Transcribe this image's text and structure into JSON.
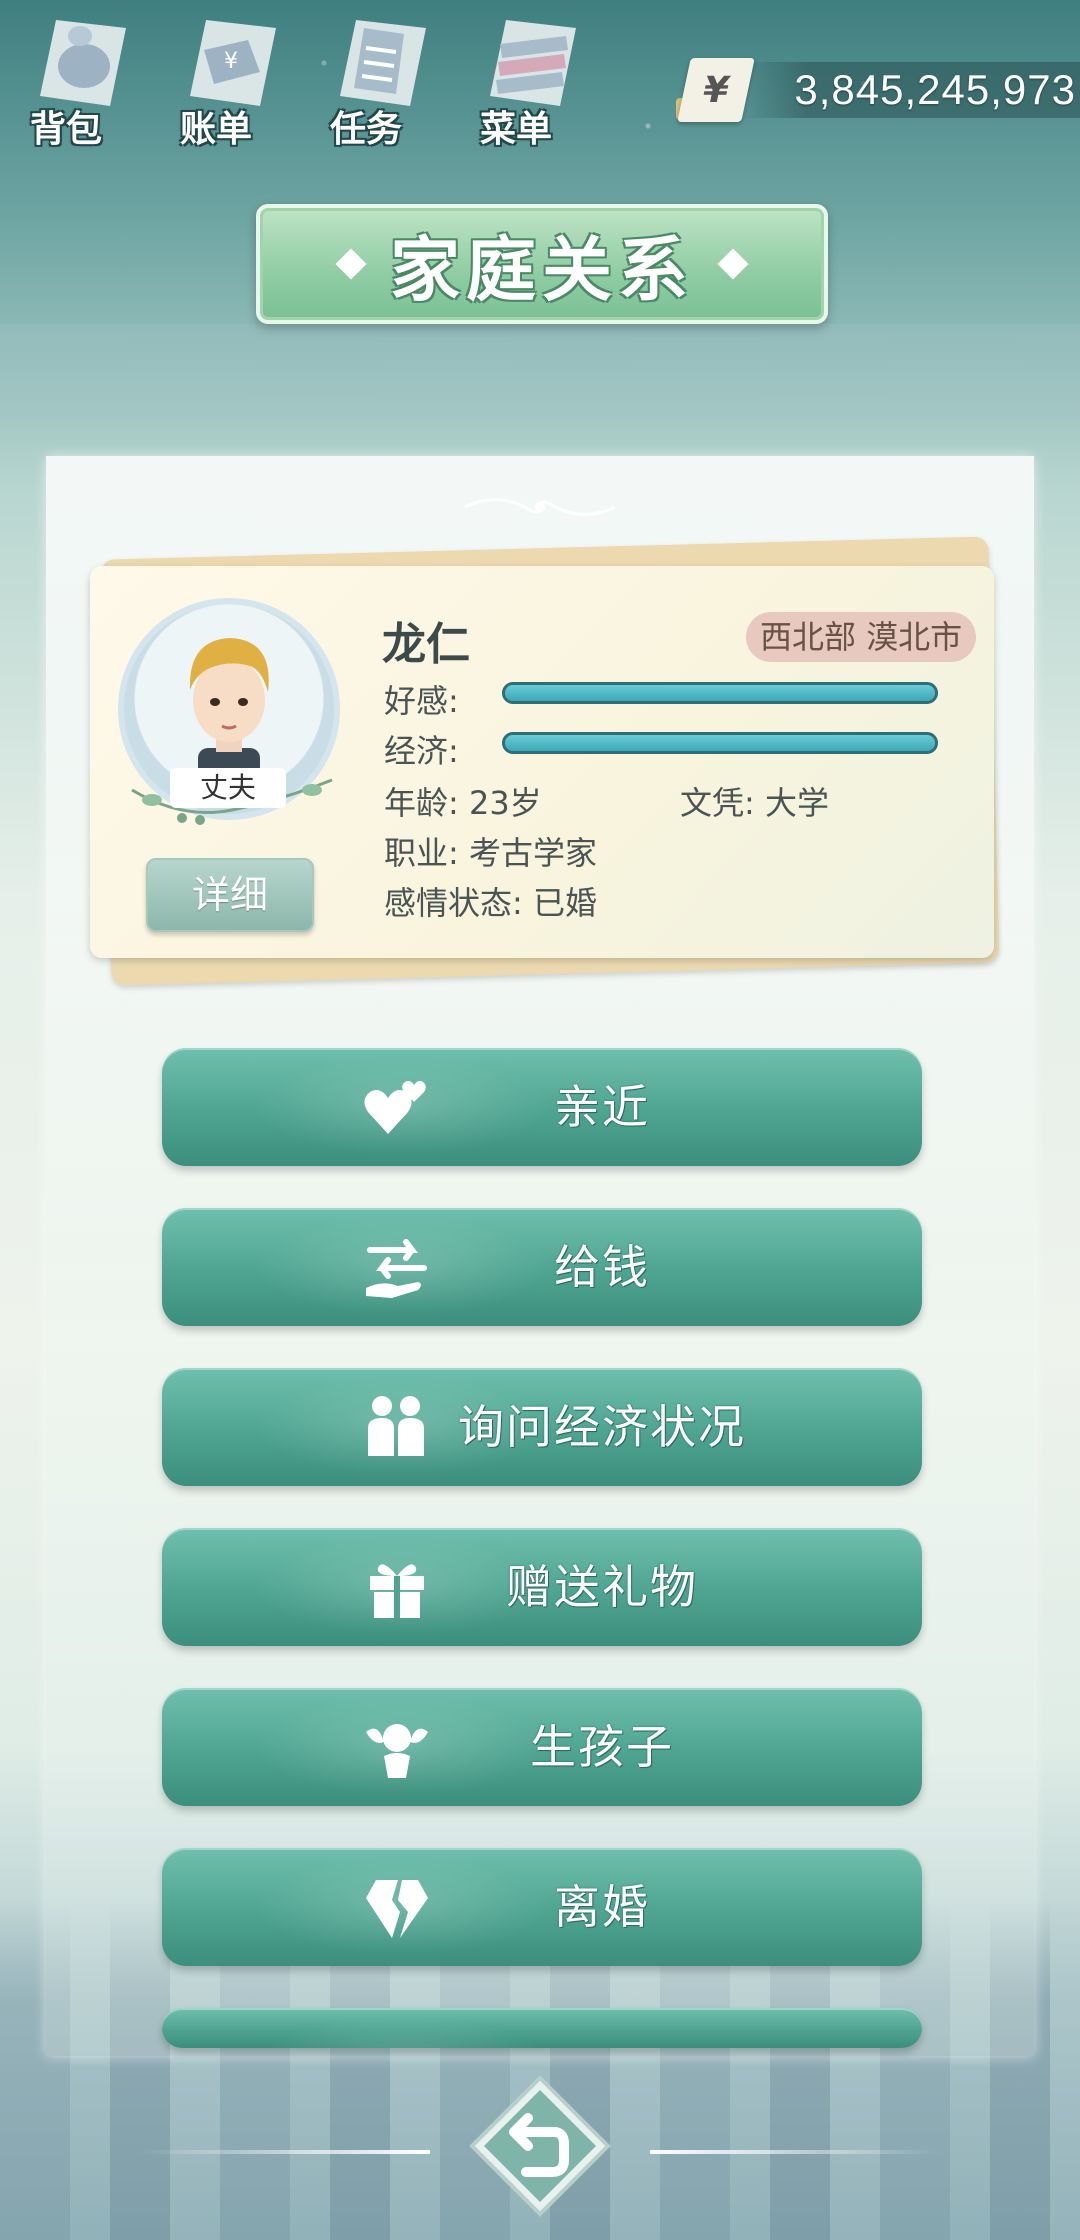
{
  "nav": {
    "items": [
      {
        "label": "背包",
        "icon": "backpack-icon"
      },
      {
        "label": "账单",
        "icon": "bill-icon"
      },
      {
        "label": "任务",
        "icon": "task-icon"
      },
      {
        "label": "菜单",
        "icon": "menu-icon"
      }
    ]
  },
  "currency": {
    "symbol": "¥",
    "value": "3,845,245,973"
  },
  "title": "家庭关系",
  "profile": {
    "name": "龙仁",
    "location": "西北部 漠北市",
    "role": "丈夫",
    "favor_label": "好感:",
    "favor_level": 1.0,
    "economy_label": "经济:",
    "economy_level": 1.0,
    "age": "年龄: 23岁",
    "education": "文凭: 大学",
    "occupation": "职业: 考古学家",
    "relationship": "感情状态: 已婚",
    "detail_button": "详细"
  },
  "actions": [
    {
      "label": "亲近",
      "icon": "hearts-icon"
    },
    {
      "label": "给钱",
      "icon": "give-money-icon"
    },
    {
      "label": "询问经济状况",
      "icon": "couple-icon"
    },
    {
      "label": "赠送礼物",
      "icon": "gift-icon"
    },
    {
      "label": "生孩子",
      "icon": "cherub-icon"
    },
    {
      "label": "离婚",
      "icon": "broken-diamond-icon"
    }
  ],
  "colors": {
    "button": "#4ea491",
    "banner": "#8fcca3",
    "bar": "#4fb8c4"
  }
}
